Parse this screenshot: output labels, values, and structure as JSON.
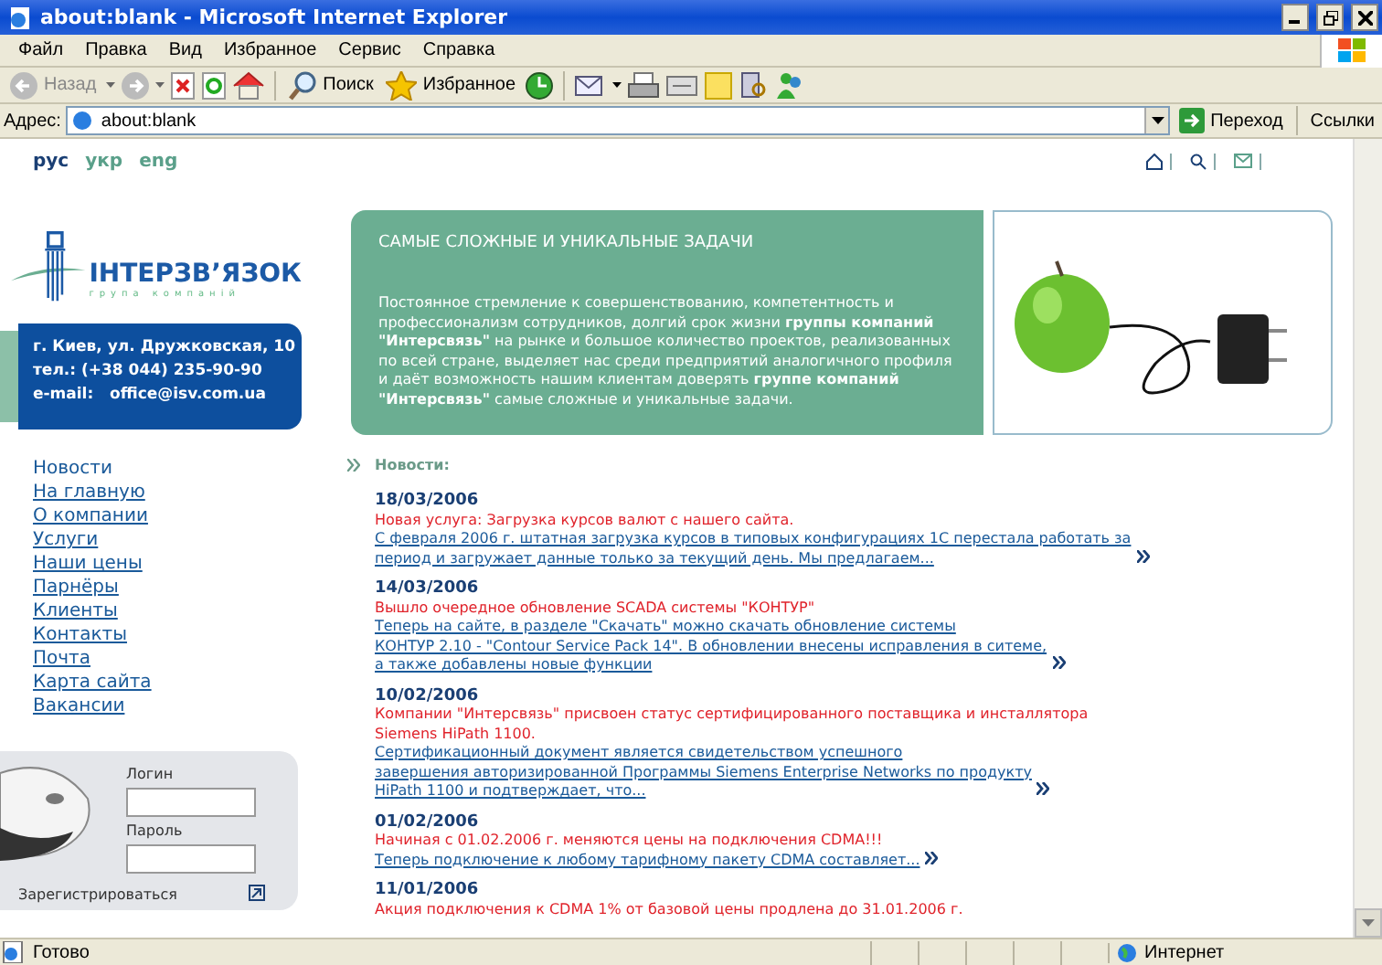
{
  "window": {
    "title": "about:blank - Microsoft Internet Explorer"
  },
  "menu": [
    "Файл",
    "Правка",
    "Вид",
    "Избранное",
    "Сервис",
    "Справка"
  ],
  "toolbar": {
    "back_label": "Назад",
    "back_disabled": true,
    "search_label": "Поиск",
    "favorites_label": "Избранное"
  },
  "address": {
    "label": "Адрес:",
    "value": "about:blank",
    "go_label": "Переход",
    "links_label": "Ссылки"
  },
  "languages": [
    {
      "label": "рус",
      "selected": true
    },
    {
      "label": "укр",
      "selected": false
    },
    {
      "label": "eng",
      "selected": false
    }
  ],
  "logo": {
    "name": "ІНТЕРЗВ’ЯЗОК",
    "subtitle": "група компаній"
  },
  "contact": {
    "address": "г. Киев, ул. Дружковская, 10",
    "phone_label": "тел.:",
    "phone": "(+38 044) 235-90-90",
    "email_label": "e-mail:",
    "email": "office@isv.com.ua"
  },
  "banner": {
    "title": "САМЫЕ СЛОЖНЫЕ И УНИКАЛЬНЫЕ ЗАДАЧИ",
    "lines": [
      "Постоянное стремление к совершенствованию, компетентность и",
      "профессионализм сотрудников, долгий срок жизни **группы компаний**",
      "**\"Интерсвязь\"** на рынке и большое количество проектов, реализованных",
      "по всей стране, выделяет нас среди предприятий аналогичного профиля",
      "и даёт возможность нашим клиентам доверять **группе компаний**",
      "**\"Интерсвязь\"** самые сложные и уникальные задачи."
    ]
  },
  "nav": [
    {
      "label": "Новости",
      "selected": true
    },
    {
      "label": "На главную",
      "selected": false
    },
    {
      "label": "О компании",
      "selected": false
    },
    {
      "label": "Услуги",
      "selected": false
    },
    {
      "label": "Наши цены",
      "selected": false
    },
    {
      "label": "Парнёры",
      "selected": false
    },
    {
      "label": "Клиенты",
      "selected": false
    },
    {
      "label": "Контакты",
      "selected": false
    },
    {
      "label": "Почта",
      "selected": false
    },
    {
      "label": "Карта сайта",
      "selected": false
    },
    {
      "label": "Вакансии",
      "selected": false
    }
  ],
  "login": {
    "login_label": "Логин",
    "password_label": "Пароль",
    "register_label": "Зарегистрироваться"
  },
  "news": {
    "heading": "Новости:",
    "items": [
      {
        "date": "18/03/2006",
        "headline": [
          "Новая услуга: Загрузка курсов валют с нашего сайта."
        ],
        "body": [
          "С февраля 2006 г. штатная загрузка курсов в типовых конфигурациях 1С перестала работать за",
          "период и загружает данные только за текущий день. Мы предлагаем..."
        ]
      },
      {
        "date": "14/03/2006",
        "headline": [
          "Вышло очередное обновление SCADA системы \"КОНТУР\""
        ],
        "body": [
          "Теперь на сайте, в разделе \"Скачать\" можно скачать обновление системы",
          "КОНТУР 2.10 - \"Contour Service Pack 14\". В обновлении внесены исправления в ситеме,",
          "а также добавлены новые функции"
        ]
      },
      {
        "date": "10/02/2006",
        "headline": [
          "Компании \"Интерсвязь\" присвоен статус сертифицированного поставщика и инсталлятора",
          "Siemens HiPath 1100."
        ],
        "body": [
          "Сертификационный документ является свидетельством успешного",
          "завершения авторизированной Программы Siemens Enterprise Networks по продукту",
          "HiPath 1100 и подтверждает, что..."
        ]
      },
      {
        "date": "01/02/2006",
        "headline": [
          "Начиная с 01.02.2006 г. меняются цены на подключения CDMA!!!"
        ],
        "body": [
          "Теперь подключение к любому тарифному пакету CDMA составляет..."
        ]
      },
      {
        "date": "11/01/2006",
        "headline": [
          "Акция подключения к CDMA 1% от базовой цены продлена до 31.01.2006 г."
        ]
      }
    ]
  },
  "status": {
    "text": "Готово",
    "zone": "Интернет"
  }
}
